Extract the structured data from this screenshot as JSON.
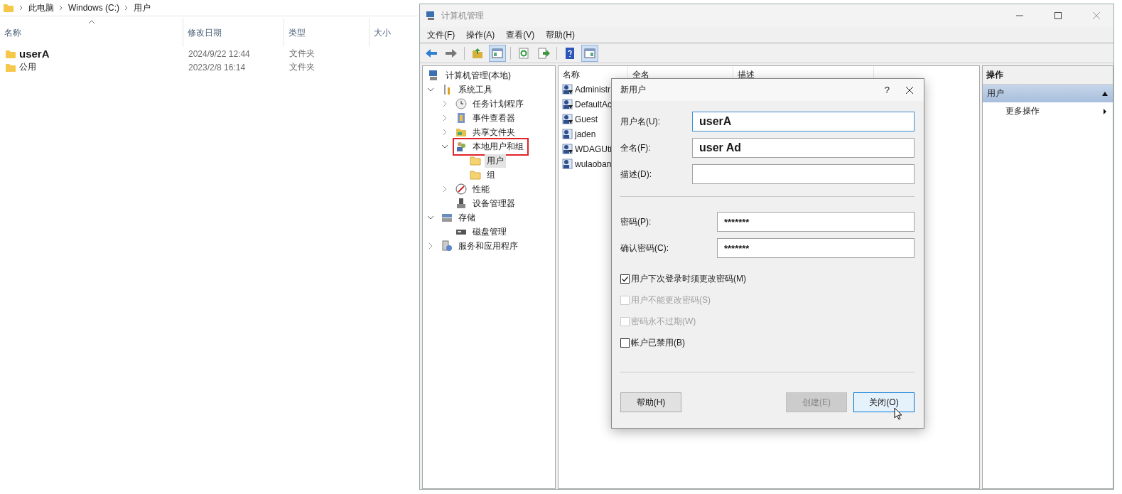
{
  "explorer": {
    "breadcrumb": [
      "此电脑",
      "Windows (C:)",
      "用户"
    ],
    "columns": [
      {
        "label": "名称",
        "sorted": true
      },
      {
        "label": "修改日期",
        "sorted": false
      },
      {
        "label": "类型",
        "sorted": false
      },
      {
        "label": "大小",
        "sorted": false
      }
    ],
    "rows": [
      {
        "name": "userA",
        "modified": "2024/9/22 12:44",
        "type": "文件夹",
        "emphasized": true
      },
      {
        "name": "公用",
        "modified": "2023/2/8 16:14",
        "type": "文件夹",
        "emphasized": false
      }
    ]
  },
  "mgmt": {
    "title": "计算机管理",
    "menu": [
      "文件(F)",
      "操作(A)",
      "查看(V)",
      "帮助(H)"
    ],
    "toolbar": [
      [
        {
          "kind": "back",
          "pressed": false
        },
        {
          "kind": "forward",
          "pressed": false
        }
      ],
      [
        {
          "kind": "up",
          "pressed": false
        },
        {
          "kind": "tree",
          "pressed": true
        }
      ],
      [
        {
          "kind": "refresh",
          "pressed": false
        },
        {
          "kind": "export",
          "pressed": false
        }
      ],
      [
        {
          "kind": "help",
          "pressed": false
        },
        {
          "kind": "panel",
          "pressed": true
        }
      ]
    ],
    "tree": [
      {
        "label": "计算机管理(本地)",
        "kind": "computer",
        "selected": false,
        "highlighted": false,
        "children": [
          {
            "label": "系统工具",
            "kind": "tools",
            "expanded": true,
            "selected": false,
            "highlighted": false,
            "children": [
              {
                "label": "任务计划程序",
                "kind": "clock",
                "expanded": false,
                "selected": false,
                "highlighted": false
              },
              {
                "label": "事件查看器",
                "kind": "log",
                "expanded": false,
                "selected": false,
                "highlighted": false
              },
              {
                "label": "共享文件夹",
                "kind": "share",
                "expanded": false,
                "selected": false,
                "highlighted": false
              },
              {
                "label": "本地用户和组",
                "kind": "users",
                "expanded": true,
                "selected": false,
                "highlighted": true,
                "children": [
                  {
                    "label": "用户",
                    "kind": "folder",
                    "selected": true,
                    "highlighted": false
                  },
                  {
                    "label": "组",
                    "kind": "folder",
                    "selected": false,
                    "highlighted": false
                  }
                ]
              },
              {
                "label": "性能",
                "kind": "perf",
                "expanded": false,
                "selected": false,
                "highlighted": false
              },
              {
                "label": "设备管理器",
                "kind": "device",
                "selected": false,
                "highlighted": false
              }
            ]
          },
          {
            "label": "存储",
            "kind": "storage",
            "expanded": true,
            "selected": false,
            "highlighted": false,
            "children": [
              {
                "label": "磁盘管理",
                "kind": "disk",
                "selected": false,
                "highlighted": false
              }
            ]
          },
          {
            "label": "服务和应用程序",
            "kind": "services",
            "expanded": false,
            "selected": false,
            "highlighted": false
          }
        ]
      }
    ],
    "list": {
      "columns": [
        "名称",
        "全名",
        "描述"
      ],
      "rows": [
        {
          "name": "Administr",
          "disabled": true
        },
        {
          "name": "DefaultAc",
          "disabled": true
        },
        {
          "name": "Guest",
          "disabled": true
        },
        {
          "name": "jaden",
          "disabled": false
        },
        {
          "name": "WDAGUti",
          "disabled": true
        },
        {
          "name": "wulaoban",
          "disabled": false
        }
      ]
    },
    "actions": {
      "title": "操作",
      "sections": [
        {
          "label": "用户",
          "expanded": true,
          "items": [
            "更多操作"
          ]
        }
      ]
    }
  },
  "dialog": {
    "title": "新用户",
    "help_glyph": "?",
    "fields": [
      {
        "kind": "account",
        "label": "用户名(U):",
        "value": "userA",
        "focused": true
      },
      {
        "kind": "account",
        "label": "全名(F):",
        "value": "user Ad",
        "focused": false
      },
      {
        "kind": "account",
        "label": "描述(D):",
        "focused": false
      },
      {
        "kind": "password",
        "label": "密码(P):",
        "value": "*******",
        "focused": false
      },
      {
        "kind": "password",
        "label": "确认密码(C):",
        "value": "*******",
        "focused": false
      }
    ],
    "checkboxes": [
      {
        "label": "用户下次登录时须更改密码(M)",
        "checked": true,
        "disabled": false
      },
      {
        "label": "用户不能更改密码(S)",
        "checked": false,
        "disabled": true
      },
      {
        "label": "密码永不过期(W)",
        "checked": false,
        "disabled": true
      },
      {
        "label": "帐户已禁用(B)",
        "checked": false,
        "disabled": false
      }
    ],
    "buttons": [
      {
        "kind": "help",
        "label": "帮助(H)",
        "disabled": false,
        "focused": false
      },
      {
        "kind": "action",
        "label": "创建(E)",
        "disabled": true,
        "focused": false
      },
      {
        "kind": "action",
        "label": "关闭(O)",
        "disabled": false,
        "focused": true
      }
    ]
  }
}
